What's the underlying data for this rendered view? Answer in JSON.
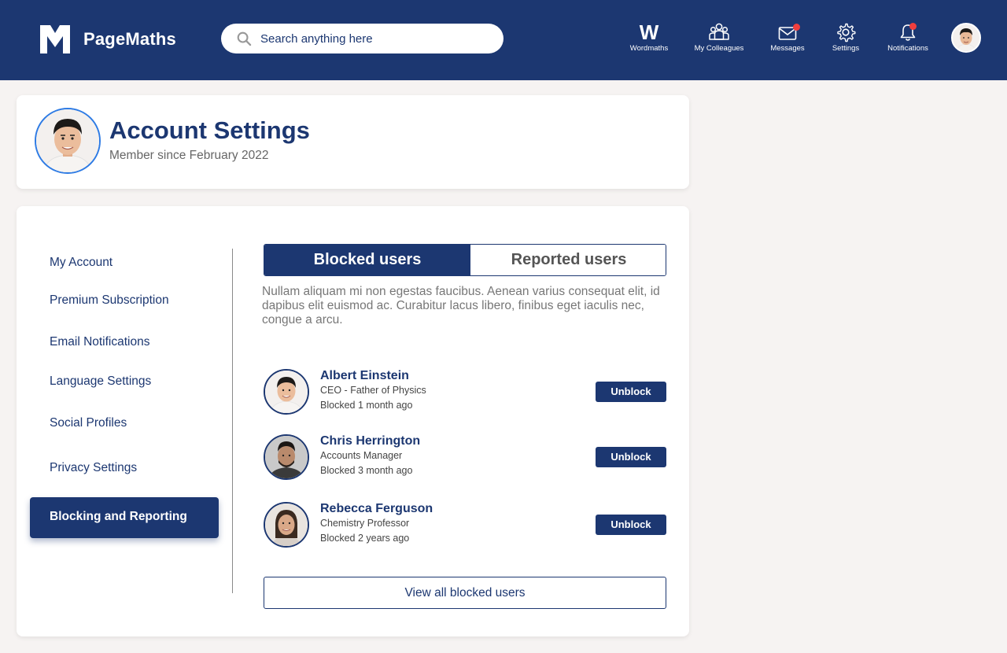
{
  "brand": {
    "name": "PageMaths",
    "logo_icon": "pm-logo"
  },
  "search": {
    "placeholder": "Search anything here"
  },
  "nav": {
    "wordmaths": {
      "glyph": "W",
      "label": "Wordmaths"
    },
    "colleagues": {
      "label": "My Colleagues"
    },
    "messages": {
      "label": "Messages",
      "has_badge": true
    },
    "settings": {
      "label": "Settings"
    },
    "notifications": {
      "label": "Notifications",
      "has_badge": true
    }
  },
  "profile": {
    "title": "Account Settings",
    "member_since": "Member since February 2022"
  },
  "menu": {
    "items": [
      "My Account",
      "Premium Subscription",
      "Email Notifications",
      "Language Settings",
      "Social Profiles",
      "Privacy Settings"
    ],
    "active": "Blocking and Reporting"
  },
  "tabs": {
    "active": "Blocked users",
    "inactive": "Reported users"
  },
  "intro": "Nullam aliquam mi non egestas faucibus. Aenean varius consequat elit, id dapibus elit euismod ac. Curabitur lacus libero, finibus eget iaculis nec, congue a arcu.",
  "blocked_users": [
    {
      "name": "Albert Einstein",
      "role": "CEO - Father of Physics",
      "blocked": "Blocked 1 month ago",
      "action": "Unblock"
    },
    {
      "name": "Chris Herrington",
      "role": "Accounts Manager",
      "blocked": "Blocked 3 month ago",
      "action": "Unblock"
    },
    {
      "name": "Rebecca Ferguson",
      "role": "Chemistry Professor",
      "blocked": "Blocked 2 years ago",
      "action": "Unblock"
    }
  ],
  "view_all_label": "View all blocked users",
  "colors": {
    "primary": "#1c3771",
    "badge": "#ef3e3e",
    "avatar_ring": "#2e7be4",
    "page_bg": "#f6f3f2"
  }
}
